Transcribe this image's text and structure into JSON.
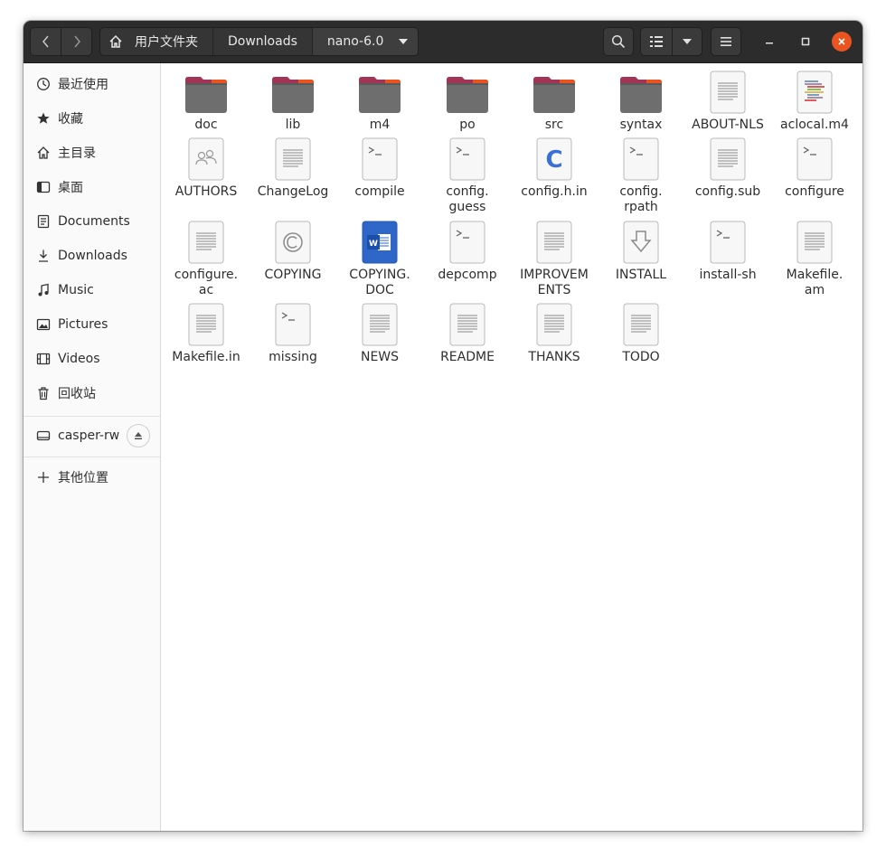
{
  "header": {
    "back_icon": "chevron-left-icon",
    "forward_icon": "chevron-right-icon",
    "breadcrumbs": [
      "用户文件夹",
      "Downloads",
      "nano-6.0"
    ],
    "search_icon": "search-icon",
    "view_icon": "list-view-icon",
    "menu_icon": "hamburger-menu-icon",
    "close_color": "#e95420"
  },
  "sidebar": {
    "items": [
      {
        "label": "最近使用",
        "icon": "clock-icon"
      },
      {
        "label": "收藏",
        "icon": "star-icon"
      },
      {
        "label": "主目录",
        "icon": "home-icon"
      },
      {
        "label": "桌面",
        "icon": "desktop-icon"
      },
      {
        "label": "Documents",
        "icon": "document-icon"
      },
      {
        "label": "Downloads",
        "icon": "download-icon"
      },
      {
        "label": "Music",
        "icon": "music-icon"
      },
      {
        "label": "Pictures",
        "icon": "picture-icon"
      },
      {
        "label": "Videos",
        "icon": "video-icon"
      },
      {
        "label": "回收站",
        "icon": "trash-icon"
      }
    ],
    "device": {
      "label": "casper-rw",
      "icon": "drive-icon",
      "eject_icon": "eject-icon"
    },
    "other": {
      "label": "其他位置",
      "icon": "plus-icon"
    }
  },
  "files": [
    {
      "name": "doc",
      "type": "folder"
    },
    {
      "name": "lib",
      "type": "folder"
    },
    {
      "name": "m4",
      "type": "folder"
    },
    {
      "name": "po",
      "type": "folder"
    },
    {
      "name": "src",
      "type": "folder"
    },
    {
      "name": "syntax",
      "type": "folder"
    },
    {
      "name": "ABOUT-NLS",
      "type": "text"
    },
    {
      "name": "aclocal.m4",
      "type": "colortext"
    },
    {
      "name": "AUTHORS",
      "type": "people"
    },
    {
      "name": "ChangeLog",
      "type": "text"
    },
    {
      "name": "compile",
      "type": "script"
    },
    {
      "name": "config.\nguess",
      "type": "script"
    },
    {
      "name": "config.h.in",
      "type": "c"
    },
    {
      "name": "config.\nrpath",
      "type": "script"
    },
    {
      "name": "config.sub",
      "type": "text"
    },
    {
      "name": "configure",
      "type": "script"
    },
    {
      "name": "configure.\nac",
      "type": "text"
    },
    {
      "name": "COPYING",
      "type": "copyright"
    },
    {
      "name": "COPYING.\nDOC",
      "type": "word"
    },
    {
      "name": "depcomp",
      "type": "script"
    },
    {
      "name": "IMPROVEM\nENTS",
      "type": "text"
    },
    {
      "name": "INSTALL",
      "type": "install"
    },
    {
      "name": "install-sh",
      "type": "script"
    },
    {
      "name": "Makefile.\nam",
      "type": "text"
    },
    {
      "name": "Makefile.in",
      "type": "text"
    },
    {
      "name": "missing",
      "type": "script"
    },
    {
      "name": "NEWS",
      "type": "text"
    },
    {
      "name": "README",
      "type": "text"
    },
    {
      "name": "THANKS",
      "type": "text"
    },
    {
      "name": "TODO",
      "type": "text"
    }
  ]
}
